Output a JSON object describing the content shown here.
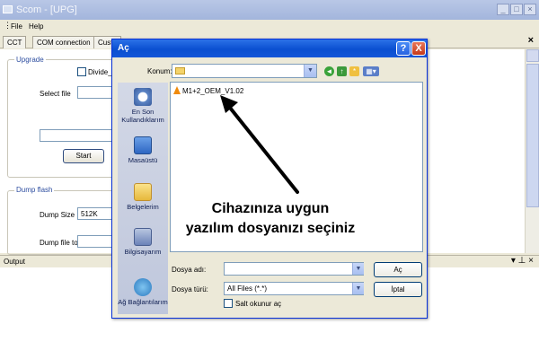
{
  "app": {
    "title": "Scom - [UPG]",
    "menu": [
      "File",
      "Help"
    ],
    "tabs": [
      "CCT",
      "COM connection",
      "Custo"
    ],
    "upgrade_group": "Upgrade",
    "divide_flash": "Divide_fla",
    "select_file": "Select file",
    "start_button": "Start",
    "dump_group": "Dump flash",
    "dump_size_label": "Dump Size",
    "dump_size_value": "512K",
    "dump_file_label": "Dump file to",
    "output_panel": "Output"
  },
  "dialog": {
    "title": "Aç",
    "look_in_label": "Konum:",
    "places": [
      "En Son Kullandıklarım",
      "Masaüstü",
      "Belgelerim",
      "Bilgisayarım",
      "Ağ Bağlantılarım"
    ],
    "files": [
      "M1+2_OEM_V1.02"
    ],
    "annotation": [
      "Cihazınıza uygun",
      "yazılım dosyanızı seçiniz"
    ],
    "filename_label": "Dosya adı:",
    "filename_value": "",
    "filetype_label": "Dosya türü:",
    "filetype_value": "All Files (*.*)",
    "readonly_label": "Salt okunur aç",
    "open_button": "Aç",
    "cancel_button": "İptal",
    "help_glyph": "?",
    "close_glyph": "X"
  },
  "colors": {
    "dialog_title": "#0a4fd0",
    "app_title_inactive": "#a3b5dc",
    "group_label": "#2e4ea0"
  }
}
